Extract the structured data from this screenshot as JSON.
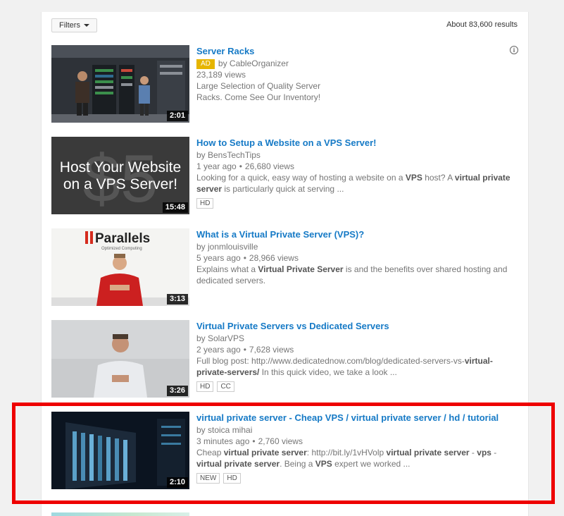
{
  "toolbar": {
    "filters_label": "Filters",
    "results_count": "About 83,600 results"
  },
  "results": [
    {
      "title": "Server Racks",
      "ad_label": "AD",
      "channel": "by CableOrganizer",
      "views": "23,189 views",
      "desc_line1": "Large Selection of Quality Server",
      "desc_line2": "Racks. Come See Our Inventory!",
      "duration": "2:01",
      "info_icon": "info-icon"
    },
    {
      "title": "How to Setup a Website on a VPS Server!",
      "channel": "by BensTechTips",
      "age": "1 year ago",
      "views": "26,680 views",
      "desc_parts": [
        "Looking for a quick, easy way of hosting a website on a ",
        "VPS",
        " host? A ",
        "virtual private server",
        " is particularly quick at serving ..."
      ],
      "duration": "15:48",
      "thumb_text_1": "Host Your Website",
      "thumb_text_2": "on a VPS Server!",
      "thumb_bg_text": "$5",
      "badges": [
        "HD"
      ]
    },
    {
      "title": "What is a Virtual Private Server (VPS)?",
      "channel": "by jonmlouisville",
      "age": "5 years ago",
      "views": "28,966 views",
      "desc_parts": [
        "Explains what a ",
        "Virtual Private Server",
        " is and the benefits over shared hosting and dedicated servers."
      ],
      "duration": "3:13",
      "thumb_logo": "Parallels",
      "thumb_tagline": "Optimized Computing"
    },
    {
      "title": "Virtual Private Servers vs Dedicated Servers",
      "channel": "by SolarVPS",
      "age": "2 years ago",
      "views": "7,628 views",
      "desc_parts": [
        "Full blog post: http://www.dedicatednow.com/blog/dedicated-servers-vs-",
        "virtual-private-servers/",
        " In this quick video, we take a look ..."
      ],
      "duration": "3:26",
      "badges": [
        "HD",
        "CC"
      ]
    },
    {
      "title": "virtual private server - Cheap VPS / virtual private server / hd / tutorial",
      "channel": "by stoica mihai",
      "age": "3 minutes ago",
      "views": "2,760 views",
      "desc_parts": [
        "Cheap ",
        "virtual private server",
        ": http://bit.ly/1vHVolp ",
        "virtual private server",
        " - ",
        "vps",
        " - ",
        "virtual private server",
        ". Being a ",
        "VPS",
        " expert we worked ..."
      ],
      "duration": "2:10",
      "badges": [
        "NEW",
        "HD"
      ]
    }
  ],
  "colors": {
    "link": "#167ac6",
    "ad": "#e6b500",
    "highlight": "#ee0000"
  }
}
